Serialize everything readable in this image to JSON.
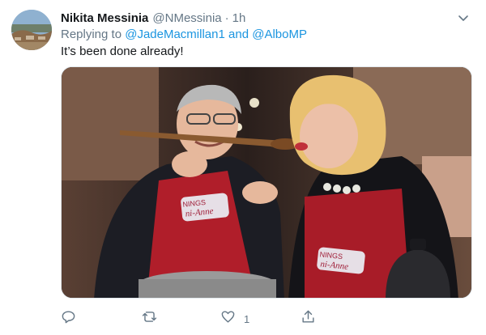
{
  "tweet": {
    "display_name": "Nikita Messinia",
    "handle": "@NMessinia",
    "separator": "·",
    "time": "1h",
    "replying_prefix": "Replying to",
    "mention_1": "@JadeMacmillan1",
    "mention_joiner": "and",
    "mention_2": "@AlboMP",
    "text": "It’s been done already!",
    "apron_text_left": "NINGS",
    "apron_text_left_2": "ni-Anne",
    "apron_text_right": "NINGS",
    "apron_text_right_2": "ni-Anne"
  },
  "actions": {
    "reply_icon": "reply-icon",
    "retweet_icon": "retweet-icon",
    "like_icon": "heart-icon",
    "like_count": "1",
    "share_icon": "share-icon"
  },
  "colors": {
    "link": "#1b95e0",
    "muted": "#657786",
    "text": "#14171a"
  }
}
